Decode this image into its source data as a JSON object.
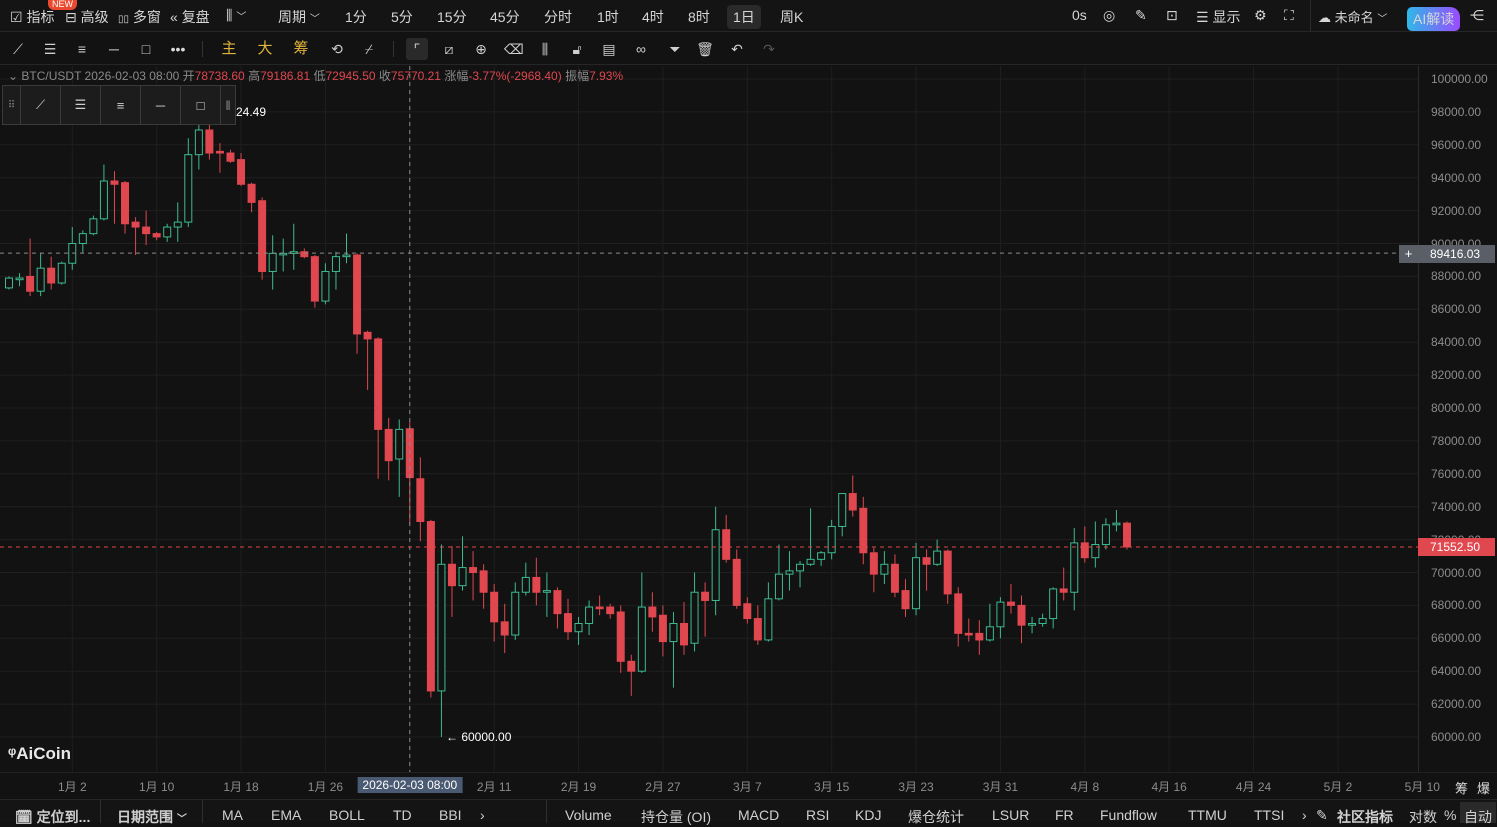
{
  "topbar": {
    "indicators": "指标",
    "new_badge": "NEW",
    "advanced": "高级",
    "multi_window": "多窗",
    "replay": "复盘",
    "period": "周期",
    "intervals": [
      "1分",
      "5分",
      "15分",
      "45分",
      "分时",
      "1时",
      "4时",
      "8时",
      "1日",
      "周K"
    ],
    "active_interval": "1日",
    "countdown": "0s",
    "display": "显示",
    "layout_name": "未命名",
    "ai_label": "AI解读"
  },
  "toolbar": {
    "main": "主",
    "big": "大",
    "chips": "筹"
  },
  "info": {
    "symbol": "BTC/USDT",
    "datetime": "2026-02-03 08:00",
    "open_label": "开",
    "open": "78738.60",
    "high_label": "高",
    "high": "79186.81",
    "low_label": "低",
    "low": "72945.50",
    "close_label": "收",
    "close": "75770.21",
    "change_label": "涨幅",
    "change": "-3.77%(-2968.40)",
    "amp_label": "振幅",
    "amp": "7.93%"
  },
  "annotations": {
    "high_mark": "24.49",
    "low_mark": "← 60000.00",
    "watermark": "AiCoin"
  },
  "crosshair": {
    "price": "89416.03",
    "date": "2026-02-03 08:00"
  },
  "last_price": "71552.50",
  "right_corner": {
    "chips": "筹",
    "liq": "爆"
  },
  "bottombar": {
    "locate": "定位到...",
    "date_range": "日期范围",
    "main_indicators": [
      "MA",
      "EMA",
      "BOLL",
      "TD",
      "BBI"
    ],
    "sub_indicators": [
      "Volume",
      "持仓量 (OI)",
      "MACD",
      "RSI",
      "KDJ",
      "爆仓统计",
      "LSUR",
      "FR",
      "Fundflow",
      "TTMU",
      "TTSI"
    ],
    "community": "社区指标",
    "log": "对数",
    "percent": "%",
    "auto": "自动"
  },
  "colors": {
    "up": "#3dbb8f",
    "down": "#e0474f",
    "bg": "#121212"
  },
  "chart_data": {
    "type": "candlestick",
    "title": "BTC/USDT 1日",
    "ylim": [
      60000,
      100000
    ],
    "y_ticks": [
      "100000.00",
      "98000.00",
      "96000.00",
      "94000.00",
      "92000.00",
      "90000.00",
      "88000.00",
      "86000.00",
      "84000.00",
      "82000.00",
      "80000.00",
      "78000.00",
      "76000.00",
      "74000.00",
      "72000.00",
      "70000.00",
      "68000.00",
      "66000.00",
      "64000.00",
      "62000.00",
      "60000.00"
    ],
    "x_ticks": [
      {
        "label": "1月 2",
        "index": 6
      },
      {
        "label": "1月 10",
        "index": 14
      },
      {
        "label": "1月 18",
        "index": 22
      },
      {
        "label": "1月 26",
        "index": 30
      },
      {
        "label": "2026-02-03 08:00",
        "index": 38,
        "highlight": true
      },
      {
        "label": "2月 11",
        "index": 46
      },
      {
        "label": "2月 19",
        "index": 54
      },
      {
        "label": "2月 27",
        "index": 62
      },
      {
        "label": "3月 7",
        "index": 70
      },
      {
        "label": "3月 15",
        "index": 78
      },
      {
        "label": "3月 23",
        "index": 86
      },
      {
        "label": "3月 31",
        "index": 94
      },
      {
        "label": "4月 8",
        "index": 102
      },
      {
        "label": "4月 16",
        "index": 110
      },
      {
        "label": "4月 24",
        "index": 118
      },
      {
        "label": "5月 2",
        "index": 126
      },
      {
        "label": "5月 10",
        "index": 134
      }
    ],
    "ohlc": [
      [
        87300,
        88000,
        87200,
        87900
      ],
      [
        87800,
        88200,
        87400,
        87900
      ],
      [
        88000,
        90300,
        86800,
        87100
      ],
      [
        87100,
        89400,
        86800,
        88500
      ],
      [
        88500,
        89200,
        87200,
        87600
      ],
      [
        87600,
        88900,
        87500,
        88800
      ],
      [
        88800,
        91000,
        88400,
        90000
      ],
      [
        90000,
        90800,
        89400,
        90600
      ],
      [
        90600,
        91700,
        90500,
        91500
      ],
      [
        91500,
        94800,
        91400,
        93800
      ],
      [
        93800,
        94400,
        91200,
        93600
      ],
      [
        93700,
        93800,
        90600,
        91200
      ],
      [
        91300,
        91600,
        89300,
        91000
      ],
      [
        91000,
        92000,
        89900,
        90600
      ],
      [
        90600,
        90700,
        90200,
        90400
      ],
      [
        90400,
        91200,
        90100,
        91000
      ],
      [
        91000,
        92500,
        90100,
        91300
      ],
      [
        91300,
        96400,
        91000,
        95400
      ],
      [
        95400,
        97200,
        94500,
        96900
      ],
      [
        96900,
        97300,
        95100,
        95500
      ],
      [
        95600,
        96100,
        94300,
        95500
      ],
      [
        95500,
        95700,
        94900,
        95000
      ],
      [
        95100,
        95500,
        93500,
        93600
      ],
      [
        93600,
        93700,
        91900,
        92500
      ],
      [
        92600,
        92800,
        87800,
        88300
      ],
      [
        88300,
        90500,
        87200,
        89400
      ],
      [
        89400,
        90300,
        88300,
        89400
      ],
      [
        89400,
        91200,
        88400,
        89500
      ],
      [
        89500,
        89700,
        89100,
        89200
      ],
      [
        89200,
        89300,
        86100,
        86500
      ],
      [
        86500,
        88800,
        86300,
        88300
      ],
      [
        88300,
        89500,
        87200,
        89200
      ],
      [
        89200,
        90600,
        88800,
        89300
      ],
      [
        89300,
        89400,
        83300,
        84500
      ],
      [
        84600,
        84700,
        81100,
        84200
      ],
      [
        84200,
        84300,
        75700,
        78700
      ],
      [
        78700,
        79400,
        75600,
        76800
      ],
      [
        76900,
        79300,
        74600,
        78700
      ],
      [
        78738.6,
        79186.81,
        72945.5,
        75770.21
      ],
      [
        75700,
        77000,
        71900,
        73100
      ],
      [
        73100,
        73200,
        62400,
        62800
      ],
      [
        62800,
        71700,
        60000,
        70500
      ],
      [
        70500,
        71600,
        67300,
        69200
      ],
      [
        69200,
        72200,
        68900,
        70300
      ],
      [
        70300,
        71300,
        68300,
        70000
      ],
      [
        70100,
        70500,
        67800,
        68800
      ],
      [
        68800,
        69300,
        65800,
        67000
      ],
      [
        67000,
        68100,
        65100,
        66200
      ],
      [
        66200,
        69400,
        65900,
        68800
      ],
      [
        68800,
        70600,
        68600,
        69700
      ],
      [
        69700,
        70900,
        68000,
        68800
      ],
      [
        68800,
        70000,
        67300,
        68900
      ],
      [
        68900,
        69100,
        66600,
        67500
      ],
      [
        67500,
        68400,
        65900,
        66400
      ],
      [
        66400,
        67300,
        65600,
        66900
      ],
      [
        66900,
        68300,
        66200,
        67900
      ],
      [
        67900,
        68600,
        67400,
        67800
      ],
      [
        67900,
        68100,
        67200,
        67500
      ],
      [
        67600,
        68000,
        63900,
        64600
      ],
      [
        64600,
        65000,
        62500,
        64000
      ],
      [
        64000,
        70000,
        63900,
        67900
      ],
      [
        67900,
        68800,
        66400,
        67300
      ],
      [
        67400,
        68000,
        64900,
        65800
      ],
      [
        65800,
        67600,
        63000,
        66900
      ],
      [
        66900,
        68200,
        65000,
        65600
      ],
      [
        65700,
        70000,
        65200,
        68800
      ],
      [
        68800,
        69400,
        66100,
        68300
      ],
      [
        68300,
        74000,
        67400,
        72600
      ],
      [
        72600,
        73500,
        70600,
        70800
      ],
      [
        70800,
        71400,
        67800,
        68000
      ],
      [
        68100,
        68500,
        66900,
        67200
      ],
      [
        67200,
        68000,
        65600,
        65900
      ],
      [
        65900,
        69400,
        65800,
        68400
      ],
      [
        68400,
        71700,
        68300,
        69900
      ],
      [
        69900,
        71300,
        68900,
        70100
      ],
      [
        70100,
        70700,
        69100,
        70500
      ],
      [
        70500,
        73900,
        70400,
        70800
      ],
      [
        70800,
        71300,
        70400,
        71200
      ],
      [
        71200,
        73200,
        70800,
        72800
      ],
      [
        72800,
        74800,
        72200,
        74800
      ],
      [
        74800,
        75900,
        73400,
        73800
      ],
      [
        73900,
        74600,
        70500,
        71200
      ],
      [
        71200,
        71500,
        68800,
        69900
      ],
      [
        69900,
        71300,
        69300,
        70500
      ],
      [
        70500,
        71100,
        68500,
        68800
      ],
      [
        68900,
        69600,
        67300,
        67800
      ],
      [
        67800,
        71800,
        67400,
        70900
      ],
      [
        70900,
        71400,
        68900,
        70500
      ],
      [
        70500,
        72000,
        70400,
        71300
      ],
      [
        71300,
        71400,
        68100,
        68700
      ],
      [
        68700,
        69100,
        65500,
        66300
      ],
      [
        66300,
        67200,
        65800,
        66200
      ],
      [
        66300,
        67100,
        65000,
        65900
      ],
      [
        65900,
        68100,
        65800,
        66700
      ],
      [
        66700,
        68500,
        66000,
        68200
      ],
      [
        68200,
        69300,
        67500,
        68000
      ],
      [
        68000,
        68600,
        65700,
        66800
      ],
      [
        66800,
        67300,
        66300,
        66900
      ],
      [
        66900,
        67500,
        66700,
        67200
      ],
      [
        67200,
        69100,
        66600,
        69000
      ],
      [
        69000,
        70300,
        68300,
        68800
      ],
      [
        68800,
        72700,
        67700,
        71800
      ],
      [
        71800,
        72800,
        70600,
        70900
      ],
      [
        70900,
        73100,
        70300,
        71700
      ],
      [
        71700,
        73300,
        71400,
        72900
      ],
      [
        72900,
        73800,
        72500,
        73000
      ],
      [
        73000,
        73100,
        71400,
        71552.5
      ]
    ]
  }
}
